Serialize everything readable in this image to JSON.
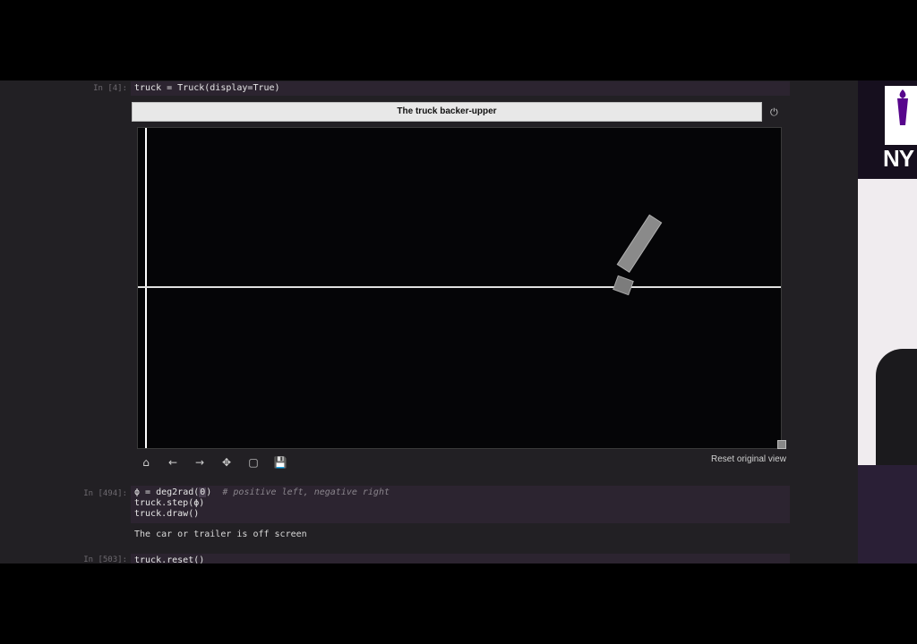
{
  "cells": [
    {
      "prompt": "In [4]:",
      "code": [
        "truck = Truck(display=True)"
      ]
    },
    {
      "prompt": "In [494]:",
      "code_line1_var": "ϕ",
      "code_line1_eq": " = deg2rad(",
      "code_line1_arg": "0",
      "code_line1_close": ")  ",
      "code_line1_comment": "# positive left, negative right",
      "code_line2": "truck.step(ϕ)",
      "code_line3": "truck.draw()",
      "output": "The car or trailer is off screen"
    },
    {
      "prompt": "In [503]:",
      "code": [
        "truck.reset()"
      ]
    }
  ],
  "figure": {
    "title": "The truck backer-upper",
    "power_icon": "power-icon",
    "reset_label": "Reset original view"
  },
  "toolbar": {
    "home": "⌂",
    "back": "←",
    "forward": "→",
    "pan": "✥",
    "zoom": "▢",
    "save": "💾"
  },
  "side": {
    "logo_text": "NY"
  },
  "colors": {
    "background": "#222024",
    "code_bg": "#2c2430",
    "canvas": "#050507",
    "truck": "#8a8a8a"
  }
}
